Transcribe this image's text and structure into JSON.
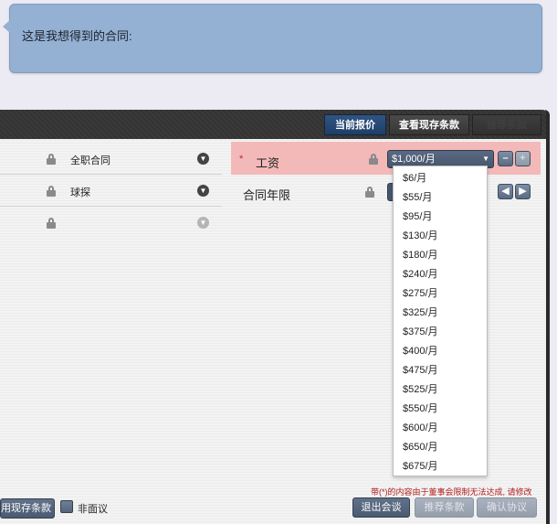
{
  "chat": {
    "message": "这是我想得到的合同:"
  },
  "tabs": {
    "current_offer": "当前报价",
    "view_terms": "查看现存条款",
    "extra": "推荐条款"
  },
  "left_rows": [
    {
      "value": "全职合同"
    },
    {
      "value": "球探"
    },
    {
      "value": ""
    }
  ],
  "salary": {
    "required_marker": "*",
    "label": "工资",
    "selected": "$1,000/月",
    "options": [
      "$6/月",
      "$55/月",
      "$95/月",
      "$130/月",
      "$180/月",
      "$240/月",
      "$275/月",
      "$325/月",
      "$375/月",
      "$400/月",
      "$475/月",
      "$525/月",
      "$550/月",
      "$600/月",
      "$650/月",
      "$675/月"
    ]
  },
  "contract_years": {
    "label": "合同年限"
  },
  "footer": {
    "warning": "带(*)的内容由于董事会限制无法达成, 请修改",
    "apply_terms": "用现存条款",
    "non_face_to_face": "非面议",
    "exit_talks": "退出会谈",
    "recommend_terms": "推荐条款",
    "confirm_agreement": "确认协议"
  },
  "colors": {
    "bubble": "#94b0d2",
    "highlight_row": "#f3b9b9",
    "warning_text": "#b31b1b"
  }
}
